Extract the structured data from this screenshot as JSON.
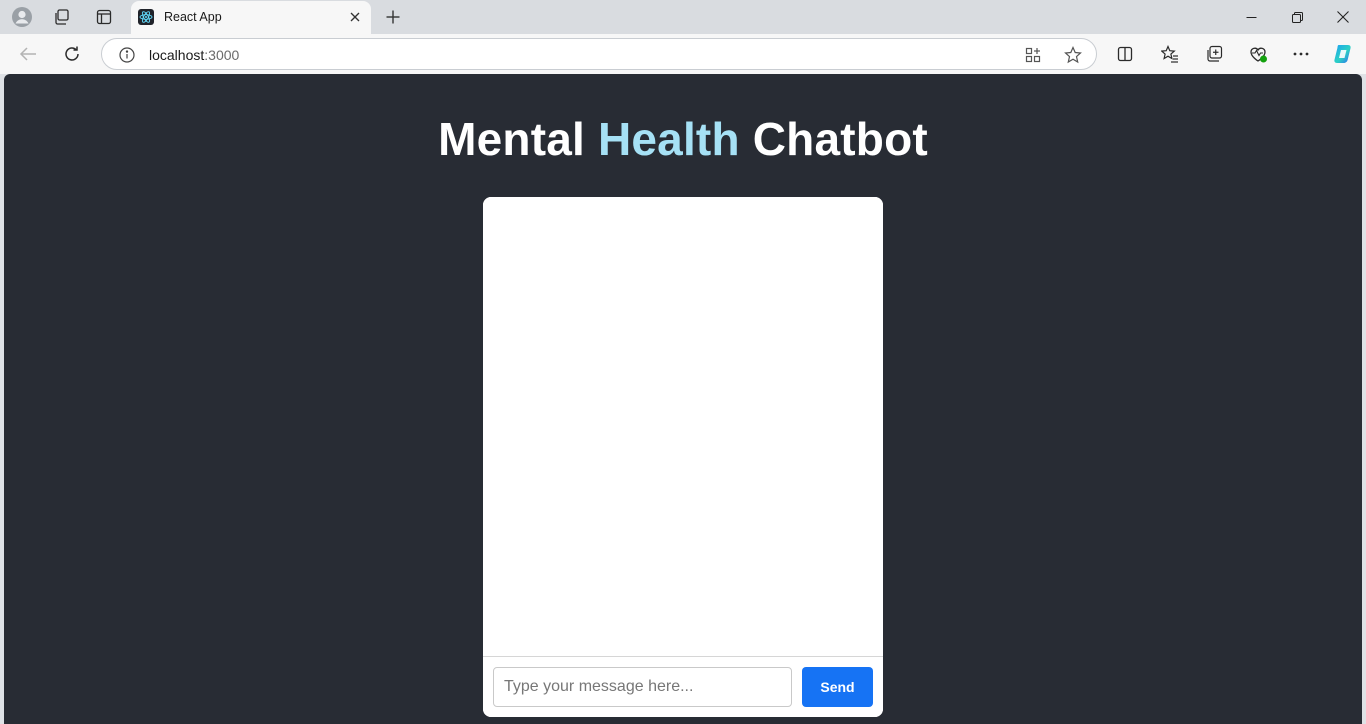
{
  "browser": {
    "tab": {
      "title": "React App"
    },
    "address": {
      "host": "localhost",
      "port": ":3000"
    }
  },
  "page": {
    "title_part1": "Mental ",
    "title_accent": "Health",
    "title_part2": " Chatbot",
    "accent_color": "#a6e1f5",
    "background_color": "#282c34"
  },
  "chat": {
    "input_placeholder": "Type your message here...",
    "input_value": "",
    "send_label": "Send",
    "send_color": "#1673f4"
  }
}
